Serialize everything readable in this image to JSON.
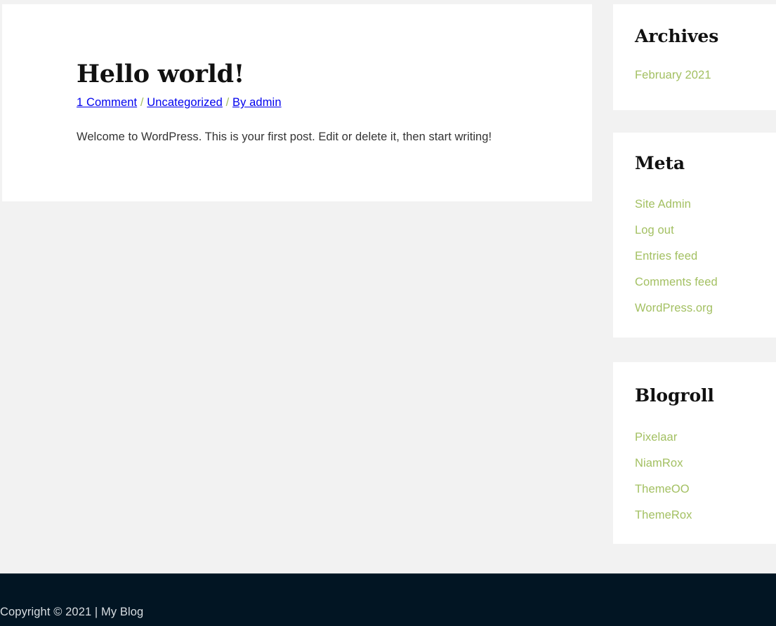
{
  "page": {
    "background_color": "#f2f2f2",
    "accent_link_color": "#a3c062",
    "card_color": "#ffffff"
  },
  "article": {
    "title": "Hello world!",
    "meta": {
      "comments": "1 Comment",
      "separator_1": " / ",
      "category": "Uncategorized",
      "separator_2": " / ",
      "author": "By admin",
      "full": "1 Comment / Uncategorized / By admin"
    },
    "body": "Welcome to WordPress. This is your first post. Edit or delete it, then start writing!"
  },
  "sidebar": {
    "widgets": [
      {
        "title": "Archives",
        "items": [
          {
            "label": "February 2021"
          }
        ]
      },
      {
        "title": "Meta",
        "items": [
          {
            "label": "Site Admin"
          },
          {
            "label": "Log out"
          },
          {
            "label": "Entries feed"
          },
          {
            "label": "Comments feed"
          },
          {
            "label": "WordPress.org"
          }
        ]
      },
      {
        "title": "Blogroll",
        "items": [
          {
            "label": "Pixelaar"
          },
          {
            "label": "NiamRox"
          },
          {
            "label": "ThemeOO"
          },
          {
            "label": "ThemeRox"
          }
        ]
      }
    ]
  },
  "footer": {
    "copyright": "Copyright © 2021 | My Blog"
  }
}
